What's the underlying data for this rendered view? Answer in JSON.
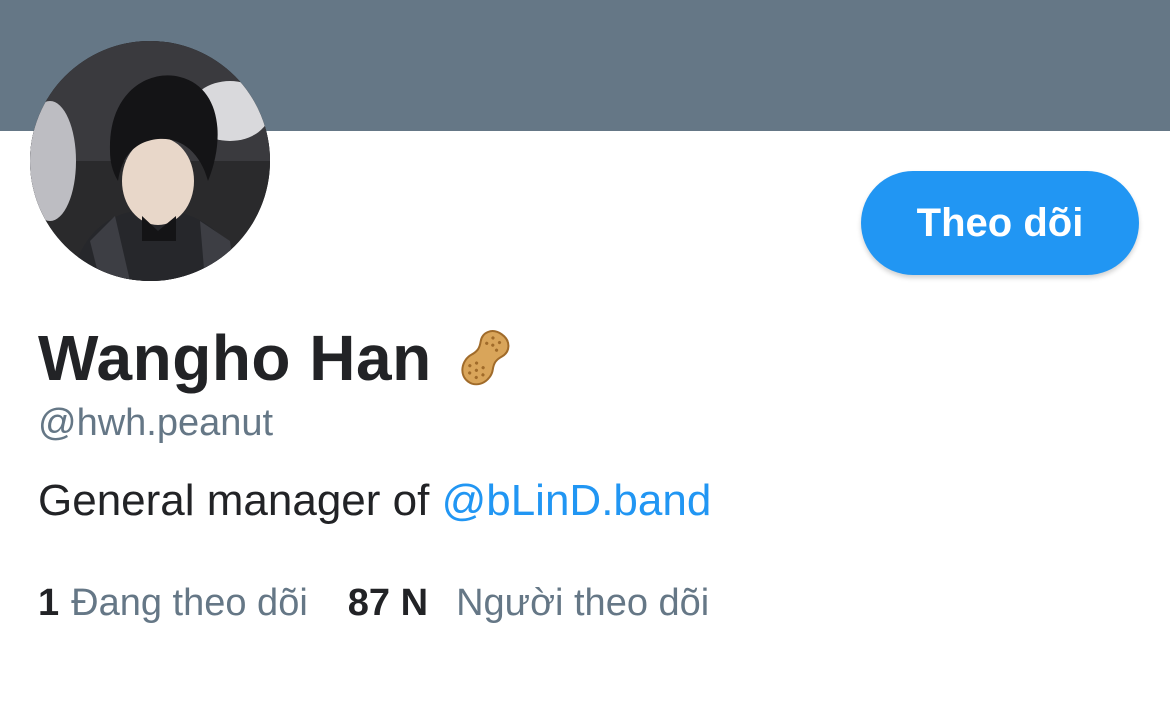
{
  "profile": {
    "name": "Wangho Han",
    "name_emoji": "peanut-icon",
    "handle": "@hwh.peanut",
    "bio_text": "General manager of ",
    "bio_link": "@bLinD.band"
  },
  "actions": {
    "follow_label": "Theo dõi"
  },
  "stats": {
    "following_count": "1",
    "following_label": "Đang theo dõi",
    "followers_count": "87 N",
    "followers_label": "Người theo dõi"
  },
  "colors": {
    "banner": "#657786",
    "accent": "#2196f3",
    "text_primary": "#222326",
    "text_secondary": "#657786"
  }
}
